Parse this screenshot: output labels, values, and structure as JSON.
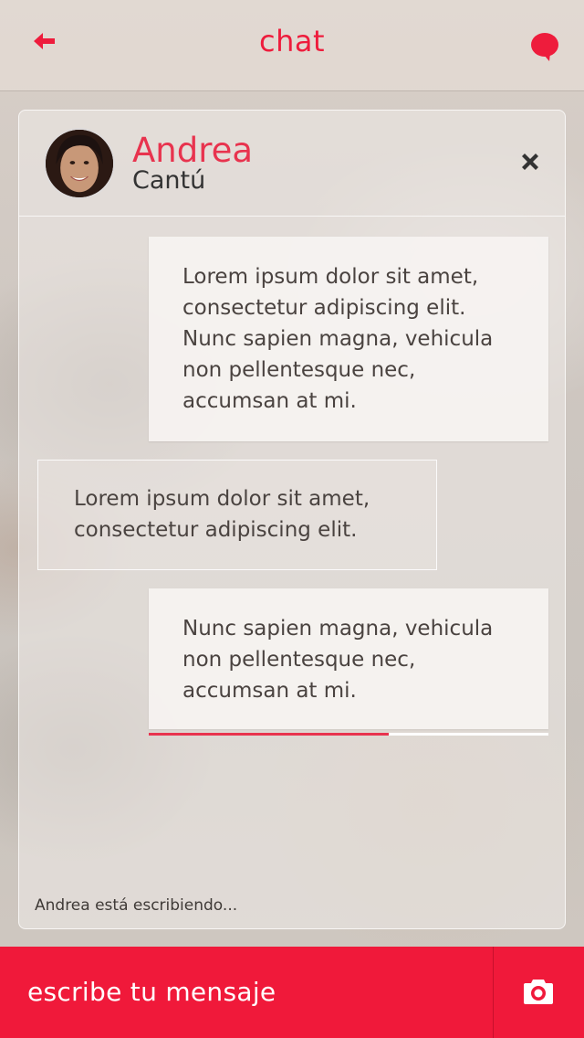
{
  "header": {
    "title": "chat",
    "accent_color": "#ee1c3c",
    "back_icon": "arrow-left-icon",
    "chat_icon": "speech-bubble-icon"
  },
  "contact": {
    "first_name": "Andrea",
    "last_name": "Cantú",
    "close_icon": "close-icon"
  },
  "messages": [
    {
      "direction": "outgoing",
      "text": "Lorem ipsum dolor sit amet, consectetur adipiscing elit. Nunc sapien magna, vehicula non pellentesque nec, accumsan at mi."
    },
    {
      "direction": "incoming",
      "text": "Lorem ipsum dolor sit amet, consectetur adipiscing elit."
    },
    {
      "direction": "outgoing",
      "text": "Nunc sapien magna, vehicula non pellentesque nec, accumsan at mi.",
      "send_progress": 0.6
    }
  ],
  "typing_status": "Andrea está escribiendo...",
  "composer": {
    "placeholder": "escribe tu mensaje",
    "camera_icon": "camera-icon",
    "background_color": "#f0193a"
  }
}
